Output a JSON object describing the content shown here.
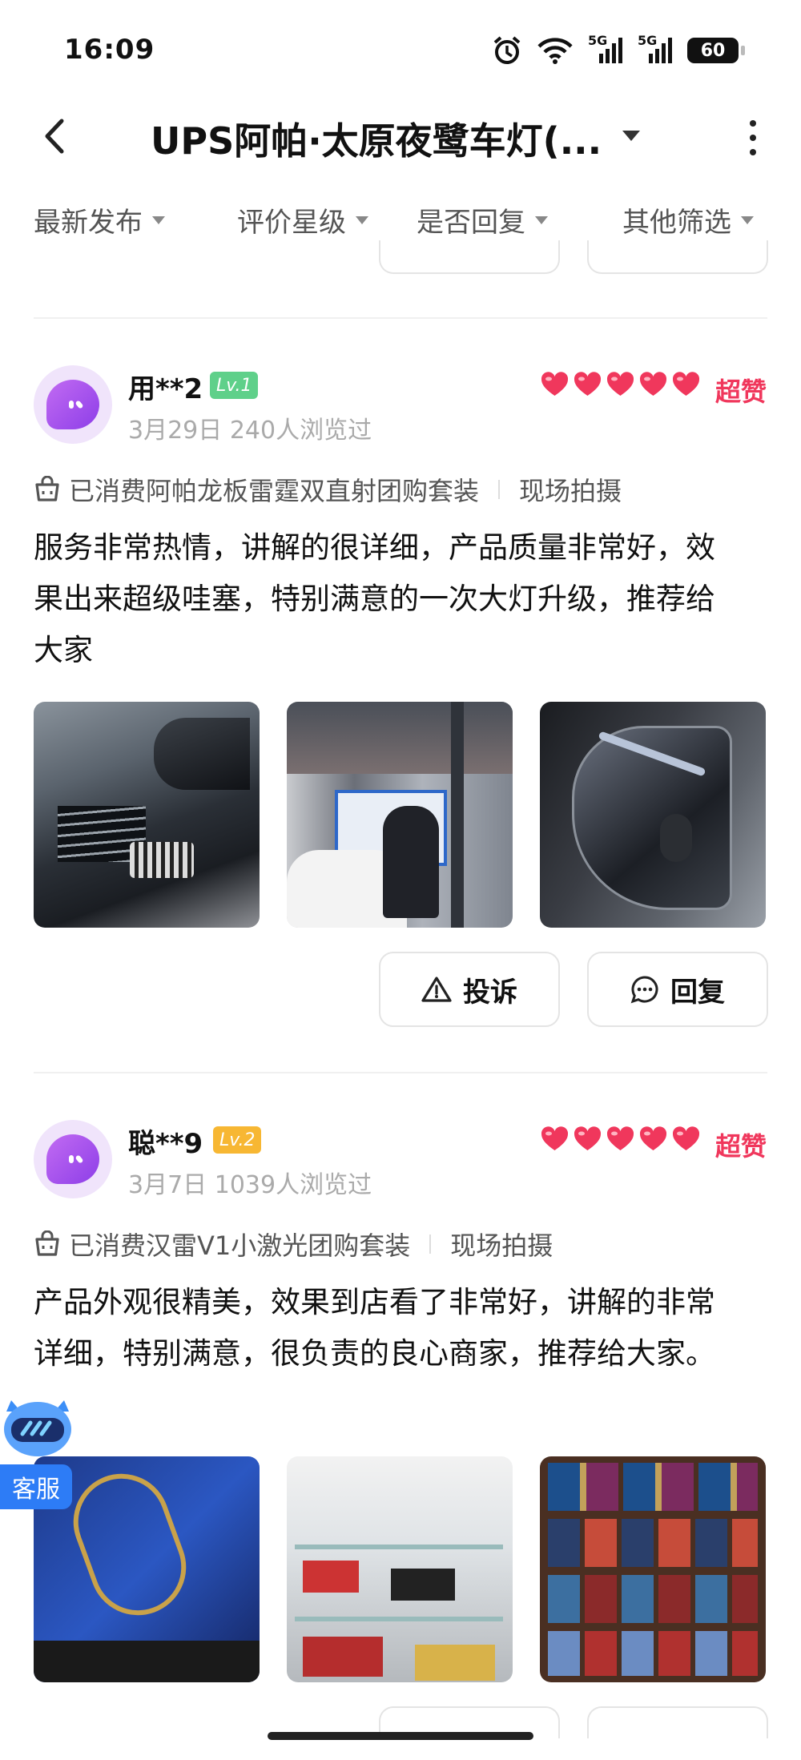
{
  "status_bar": {
    "time": "16:09",
    "battery": "60",
    "network_1": "5G",
    "network_2": "5G"
  },
  "header": {
    "title": "UPS阿帕·太原夜鹭车灯(...",
    "back_icon": "chevron-left-icon",
    "more_icon": "more-vertical-icon"
  },
  "filters": [
    {
      "label": "最新发布"
    },
    {
      "label": "评价星级"
    },
    {
      "label": "是否回复"
    },
    {
      "label": "其他筛选"
    }
  ],
  "reviews": [
    {
      "username": "用**2",
      "level": "Lv.1",
      "level_color": "#5fd08a",
      "date": "3月29日",
      "views": "240人浏览过",
      "hearts": 5,
      "rating_text": "超赞",
      "consumed": "已消费阿帕龙板雷霆双直射团购套装",
      "tag": "现场拍摄",
      "content": "服务非常热情，讲解的很详细，产品质量非常好，效果出来超级哇塞，特别满意的一次大灯升级，推荐给大家",
      "complain_label": "投诉",
      "reply_label": "回复"
    },
    {
      "username": "聪**9",
      "level": "Lv.2",
      "level_color": "#f7b733",
      "date": "3月7日",
      "views": "1039人浏览过",
      "hearts": 5,
      "rating_text": "超赞",
      "consumed": "已消费汉雷V1小激光团购套装",
      "tag": "现场拍摄",
      "content": "产品外观很精美，效果到店看了非常好，讲解的非常详细，特别满意，很负责的良心商家，推荐给大家。"
    }
  ],
  "service": {
    "label": "客服"
  },
  "colors": {
    "accent": "#f0375c",
    "service_blue": "#2d7cf6"
  }
}
